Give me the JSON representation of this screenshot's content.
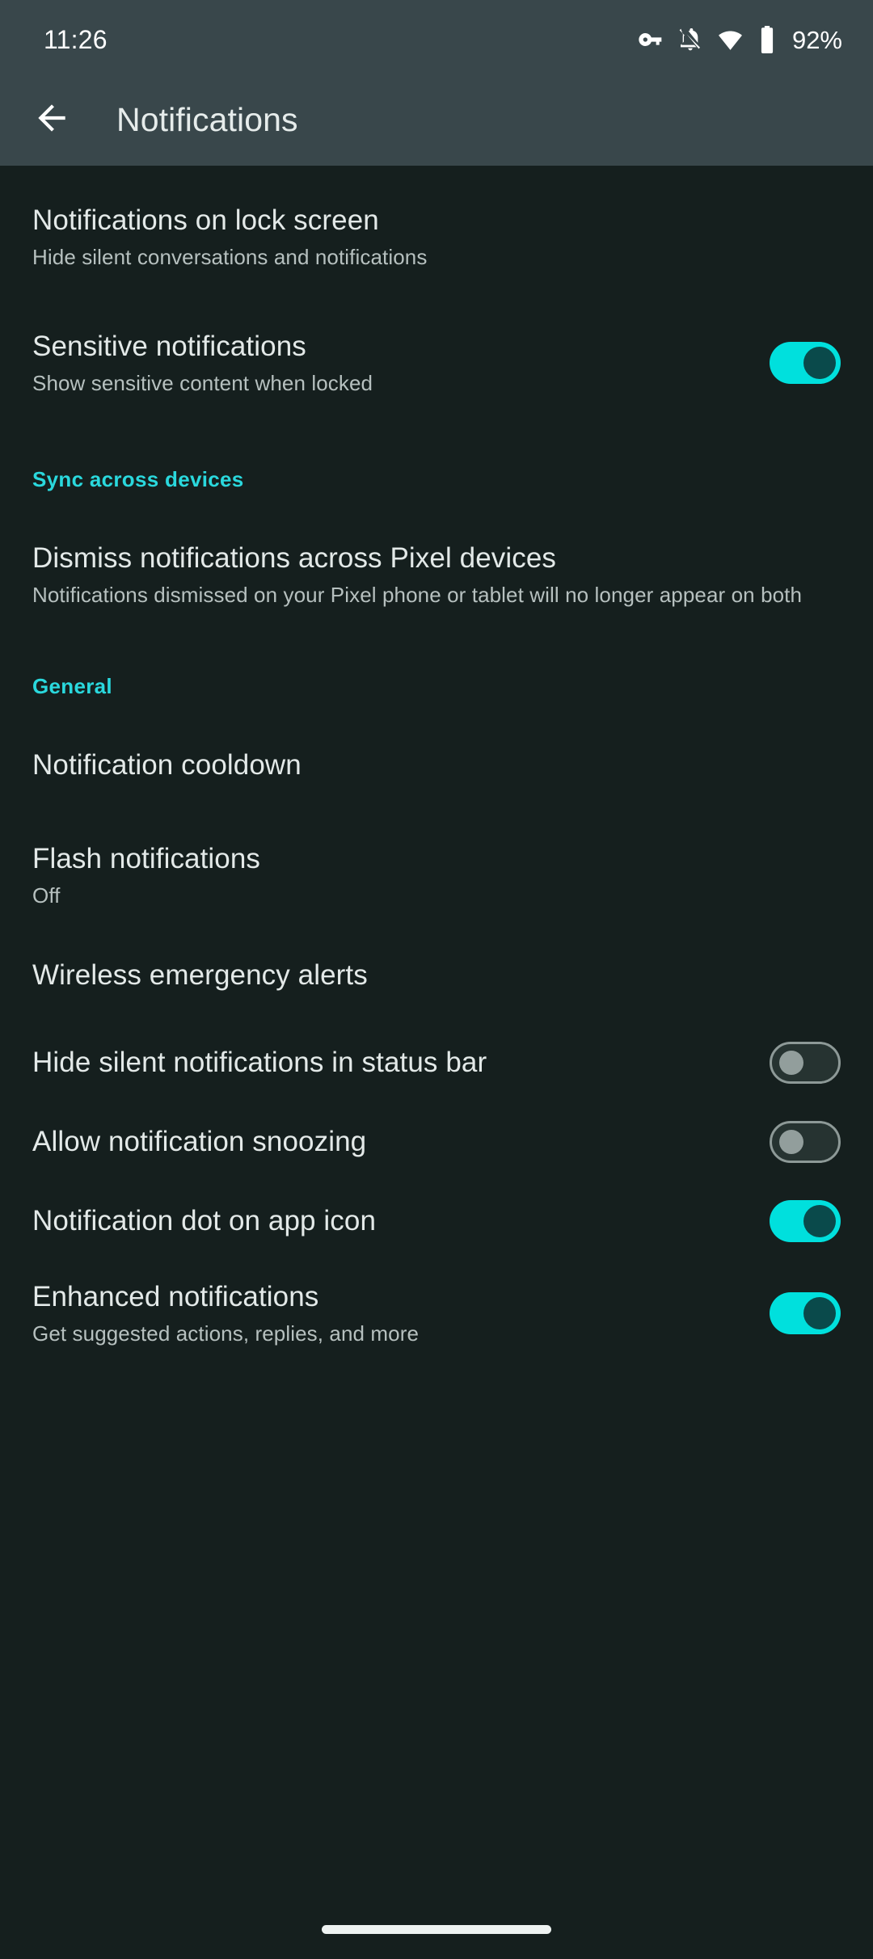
{
  "status_bar": {
    "time": "11:26",
    "battery_percent": "92%",
    "icons": [
      "vpn-key-icon",
      "ringer-mute-icon",
      "wifi-icon",
      "battery-icon"
    ]
  },
  "app_bar": {
    "back_label": "back-arrow",
    "title": "Notifications"
  },
  "colors": {
    "app_bar_background": "#39474b",
    "page_background": "#151f1e",
    "section_header_accent": "#2ad8dd",
    "switch_on_track": "#00e0dd",
    "switch_on_thumb": "#0a4a4b",
    "switch_off_track": "#263331",
    "switch_off_border": "#8d9997",
    "switch_off_thumb": "#929e9c",
    "primary_text": "#e3e9e8",
    "secondary_text": "#b6c0bf"
  },
  "settings": {
    "lock_screen": {
      "title": "Notifications on lock screen",
      "subtitle": "Hide silent conversations and notifications"
    },
    "sensitive": {
      "title": "Sensitive notifications",
      "subtitle": "Show sensitive content when locked",
      "toggle": "on"
    },
    "sync_section": {
      "header": "Sync across devices",
      "dismiss": {
        "title": "Dismiss notifications across Pixel devices",
        "subtitle": "Notifications dismissed on your Pixel phone or tablet will no longer appear on both"
      }
    },
    "general_section": {
      "header": "General",
      "cooldown": {
        "title": "Notification cooldown"
      },
      "flash": {
        "title": "Flash notifications",
        "subtitle": "Off"
      },
      "emergency": {
        "title": "Wireless emergency alerts"
      },
      "hide_silent": {
        "title": "Hide silent notifications in status bar",
        "toggle": "off"
      },
      "snoozing": {
        "title": "Allow notification snoozing",
        "toggle": "off"
      },
      "dot": {
        "title": "Notification dot on app icon",
        "toggle": "on"
      },
      "enhanced": {
        "title": "Enhanced notifications",
        "subtitle": "Get suggested actions, replies, and more",
        "toggle": "on"
      }
    }
  },
  "nav_bar": {
    "gesture_pill": "home-gesture-pill"
  }
}
